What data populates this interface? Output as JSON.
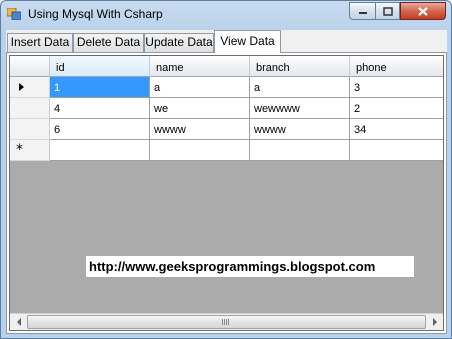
{
  "window": {
    "title": "Using Mysql With Csharp"
  },
  "tabs": [
    {
      "label": "Insert Data"
    },
    {
      "label": "Delete Data"
    },
    {
      "label": "Update Data"
    },
    {
      "label": "View Data"
    }
  ],
  "active_tab": "View Data",
  "grid": {
    "columns": [
      "id",
      "name",
      "branch",
      "phone"
    ],
    "rows": [
      [
        "1",
        "a",
        "a",
        "3"
      ],
      [
        "4",
        "we",
        "wewwww",
        "2"
      ],
      [
        "6",
        "wwww",
        "wwww",
        "34"
      ]
    ],
    "new_row_marker": "*"
  },
  "watermark": {
    "text": "http://www.geeksprogrammings.blogspot.com"
  },
  "colors": {
    "selection": "#3399ff",
    "grid_background": "#ababab",
    "close_button": "#c13d24"
  }
}
